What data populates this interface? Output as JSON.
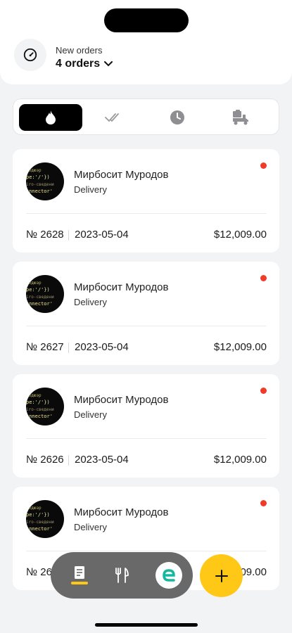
{
  "header": {
    "label": "New orders",
    "count": "4 orders"
  },
  "tabs": [
    {
      "icon": "flame-icon",
      "active": true
    },
    {
      "icon": "double-check-icon",
      "active": false
    },
    {
      "icon": "clock-icon",
      "active": false
    },
    {
      "icon": "delivery-truck-icon",
      "active": false
    }
  ],
  "orders": [
    {
      "name": "Мирбосит Муродов",
      "type": "Delivery",
      "number": "№ 2628",
      "date": "2023-05-04",
      "price": "$12,009.00"
    },
    {
      "name": "Мирбосит Муродов",
      "type": "Delivery",
      "number": "№ 2627",
      "date": "2023-05-04",
      "price": "$12,009.00"
    },
    {
      "name": "Мирбосит Муродов",
      "type": "Delivery",
      "number": "№ 2626",
      "date": "2023-05-04",
      "price": "$12,009.00"
    },
    {
      "name": "Мирбосит Муродов",
      "type": "Delivery",
      "number": "№ 2625",
      "date": "2023-05-04",
      "price": "$12,009.00"
    }
  ],
  "avatar_text": [
    "водюэр",
    "pe:'/'})",
    "iro-сведени",
    "onnector'"
  ],
  "bottom_nav": [
    {
      "icon": "orders-document-icon",
      "active": true
    },
    {
      "icon": "fork-knife-icon",
      "active": false
    },
    {
      "icon": "brand-e-icon",
      "active": false
    }
  ],
  "fab": {
    "icon": "plus-icon"
  },
  "colors": {
    "accent": "#ffc817",
    "status_dot": "#f23a2a",
    "bottom_bar": "#696969"
  }
}
